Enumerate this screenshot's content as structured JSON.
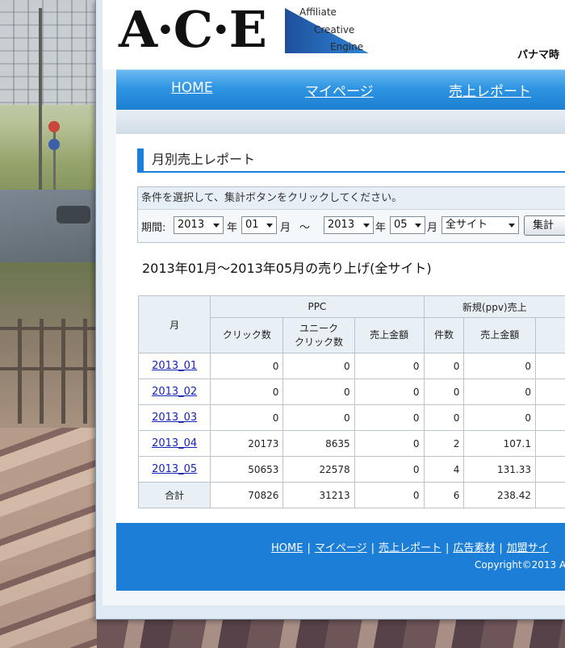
{
  "logo": {
    "text": "A·C·E",
    "line1": "Affiliate",
    "line2": "Creative",
    "line3": "Engine"
  },
  "header": {
    "user_name": "パナマ時"
  },
  "nav": {
    "home": "HOME",
    "mypage": "マイページ",
    "sales_report": "売上レポート"
  },
  "section_title": "月別売上レポート",
  "filter": {
    "hint": "条件を選択して、集計ボタンをクリックしてください。",
    "period_label": "期間:",
    "start_year": "2013",
    "year_unit": "年",
    "start_month": "01",
    "month_unit": "月",
    "range_sep": "～",
    "end_year": "2013",
    "end_month": "05",
    "site": "全サイト",
    "submit_label": "集計"
  },
  "report_title": "2013年01月～2013年05月の売り上げ(全サイト)",
  "table": {
    "month_header": "月",
    "group_ppc": "PPC",
    "group_new": "新規(ppv)売上",
    "col_clicks": "クリック数",
    "col_unique_1": "ユニーク",
    "col_unique_2": "クリック数",
    "col_sales": "売上金額",
    "col_count": "件数",
    "col_new_sales": "売上金額",
    "rows": [
      {
        "month": "2013_01",
        "clicks": "0",
        "unique": "0",
        "sales": "0",
        "count": "0",
        "new_sales": "0"
      },
      {
        "month": "2013_02",
        "clicks": "0",
        "unique": "0",
        "sales": "0",
        "count": "0",
        "new_sales": "0"
      },
      {
        "month": "2013_03",
        "clicks": "0",
        "unique": "0",
        "sales": "0",
        "count": "0",
        "new_sales": "0"
      },
      {
        "month": "2013_04",
        "clicks": "20173",
        "unique": "8635",
        "sales": "0",
        "count": "2",
        "new_sales": "107.1"
      },
      {
        "month": "2013_05",
        "clicks": "50653",
        "unique": "22578",
        "sales": "0",
        "count": "4",
        "new_sales": "131.33"
      }
    ],
    "total": {
      "label": "合計",
      "clicks": "70826",
      "unique": "31213",
      "sales": "0",
      "count": "6",
      "new_sales": "238.42"
    }
  },
  "footer": {
    "home": "HOME",
    "mypage": "マイページ",
    "sales_report": "売上レポート",
    "ad_materials": "広告素材",
    "member_site": "加盟サイ",
    "separator": "|",
    "copyright": "Copyright©2013 A"
  },
  "colors": {
    "accent": "#1a7fd8",
    "nav_blue": "#2f95e3",
    "link": "#1523b8",
    "footer": "#1c7ed6"
  }
}
